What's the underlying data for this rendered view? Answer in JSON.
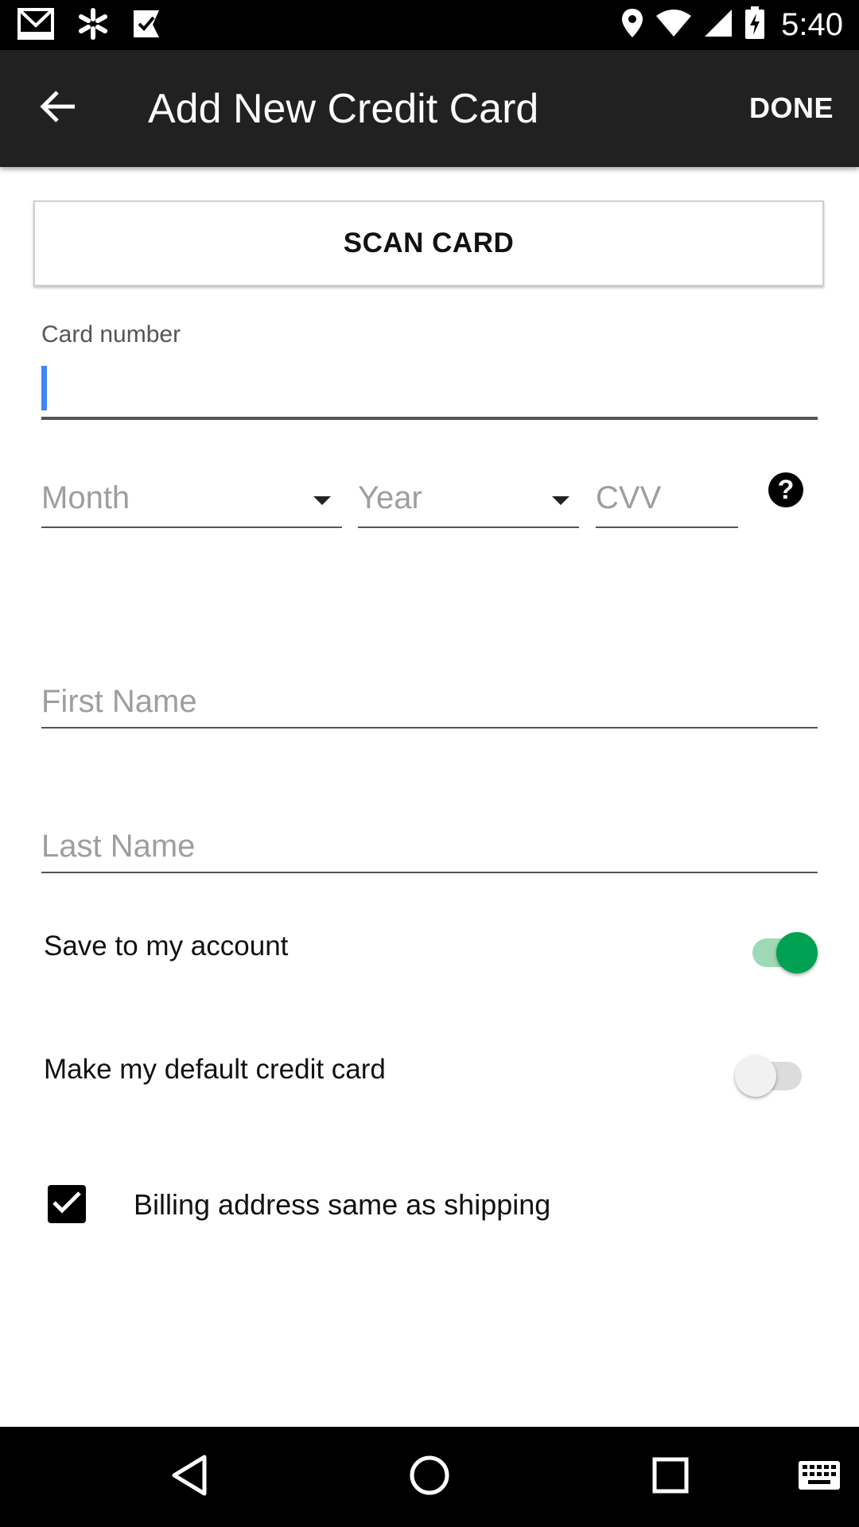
{
  "status_bar": {
    "time": "5:40",
    "left_icons": [
      "gmail-icon",
      "walmart-spark-icon",
      "checkmark-app-icon"
    ],
    "right_icons": [
      "location-icon",
      "wifi-icon",
      "signal-icon",
      "battery-charging-icon"
    ]
  },
  "app_bar": {
    "back_icon": "arrow-back-icon",
    "title": "Add New Credit Card",
    "done_label": "DONE"
  },
  "scan_card": {
    "label": "SCAN CARD"
  },
  "card_number": {
    "label": "Card number",
    "value": ""
  },
  "expiry": {
    "month_placeholder": "Month",
    "year_placeholder": "Year",
    "cvv_placeholder": "CVV",
    "help_icon": "help-icon"
  },
  "first_name": {
    "placeholder": "First Name",
    "value": ""
  },
  "last_name": {
    "placeholder": "Last Name",
    "value": ""
  },
  "save_to_account": {
    "label": "Save to my account",
    "on": true
  },
  "default_card": {
    "label": "Make my default credit card",
    "on": false
  },
  "billing_same": {
    "label": "Billing address same as shipping",
    "checked": true
  },
  "nav_bar": {
    "icons": [
      "back-icon",
      "home-icon",
      "recents-icon",
      "keyboard-icon"
    ]
  },
  "colors": {
    "app_bar": "#212121",
    "cursor": "#3f86f7",
    "toggle_on": "#00a152",
    "toggle_on_track": "#9ed9b7"
  }
}
